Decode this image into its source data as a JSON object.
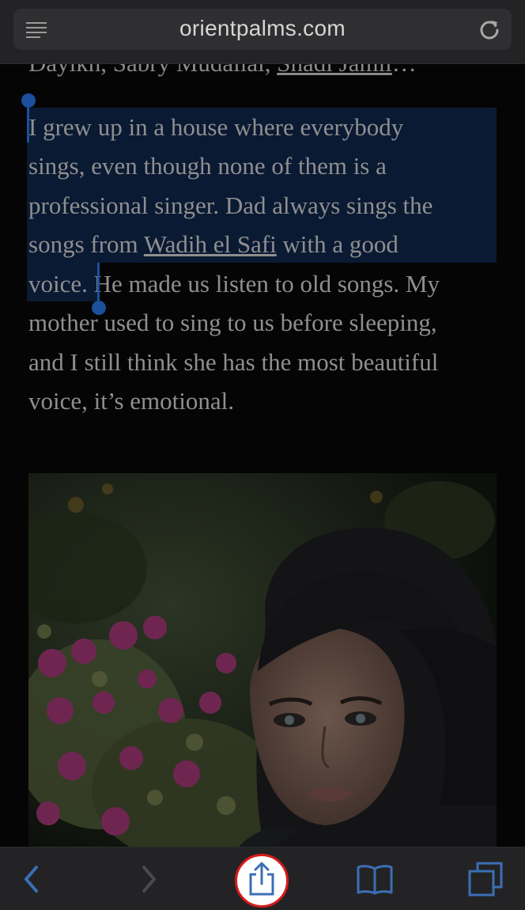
{
  "browser": {
    "url": "orientpalms.com"
  },
  "article": {
    "byline": {
      "before": "Dayikh, Sabry Mudallal, ",
      "link": "Shadi Jamil",
      "after": "…"
    },
    "paragraph_lines": [
      {
        "text": "I grew up in a house where everybody"
      },
      {
        "text": "sings, even though none of them is a"
      },
      {
        "text": "professional singer. Dad always sings the"
      },
      {
        "before": "songs from ",
        "link": "Wadih el Safi",
        "after": " with a good"
      },
      {
        "selected": "voice. ",
        "rest": "He made us listen to old songs. My"
      },
      {
        "text": "mother used to sing to us before sleeping,"
      },
      {
        "text": "and I still think she has the most beautiful"
      },
      {
        "text": "voice, it’s emotional."
      }
    ]
  },
  "toolbar": {
    "items": [
      {
        "icon": "back-chevron-icon",
        "enabled": true
      },
      {
        "icon": "forward-chevron-icon",
        "enabled": false
      },
      {
        "icon": "share-icon",
        "highlighted": true
      },
      {
        "icon": "bookmarks-icon",
        "enabled": true
      },
      {
        "icon": "tabs-icon",
        "enabled": true
      }
    ]
  },
  "colors": {
    "accent": "#1c4f9c",
    "toolbar_icon": "#3b6fb5",
    "highlight_ring": "#d71a1a",
    "selection": "#0a1a33"
  }
}
